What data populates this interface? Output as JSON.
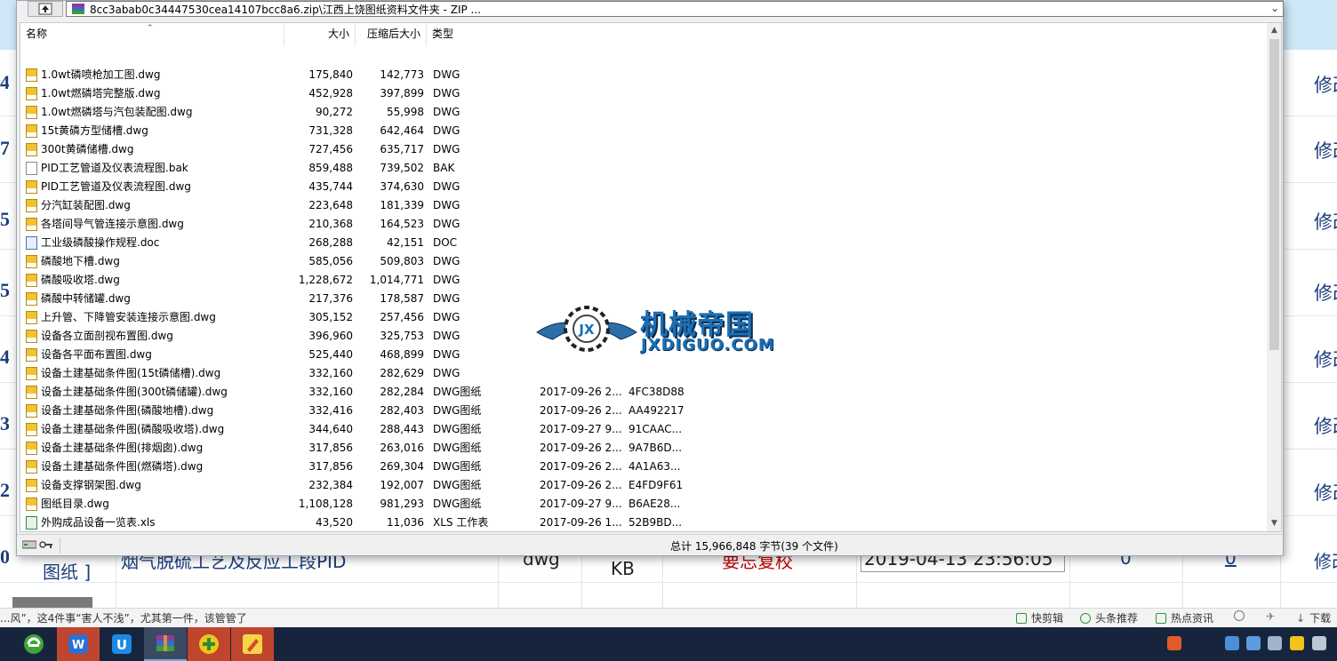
{
  "colors": {
    "bg_topbar": "#cfe8f8",
    "bg_link": "#1a3d7c",
    "bg_red_text": "#c00000",
    "taskbar": "#16253d",
    "watermark": "#1a6fb5"
  },
  "background_page": {
    "left_numbers": [
      "4",
      "7",
      "5",
      "5",
      "4",
      "3",
      "2",
      "0"
    ],
    "edit_label": "修改",
    "last_row": {
      "category": "图纸 ]",
      "title": "烟气脱硫工艺及反应工段PID",
      "format": "dwg",
      "size_unit": "KB",
      "red_text": "要忘复校",
      "datetime": "2019-04-13 23:56:05",
      "count1": "0",
      "count2": "0",
      "edit": "修改"
    }
  },
  "browser_status": {
    "news": "...风”，这4件事“害人不浅”，尤其第一件，该管管了",
    "items": [
      "快剪辑",
      "头条推荐",
      "热点资讯",
      "下载"
    ]
  },
  "winrar": {
    "path": "8cc3abab0c34447530cea14107bcc8a6.zip\\江西上饶图纸资料文件夹 - ZIP ...",
    "columns": {
      "name": "名称",
      "size": "大小",
      "packed": "压缩后大小",
      "type": "类型"
    },
    "files": [
      {
        "name": "1.0wt磷喷枪加工图.dwg",
        "size": "175,840",
        "packed": "142,773",
        "type": "DWG",
        "modified": "",
        "crc": "",
        "icon": "dwg-icon"
      },
      {
        "name": "1.0wt燃磷塔完整版.dwg",
        "size": "452,928",
        "packed": "397,899",
        "type": "DWG",
        "modified": "",
        "crc": "",
        "icon": "dwg-icon"
      },
      {
        "name": "1.0wt燃磷塔与汽包装配图.dwg",
        "size": "90,272",
        "packed": "55,998",
        "type": "DWG",
        "modified": "",
        "crc": "",
        "icon": "dwg-icon"
      },
      {
        "name": "15t黄磷方型储槽.dwg",
        "size": "731,328",
        "packed": "642,464",
        "type": "DWG",
        "modified": "",
        "crc": "",
        "icon": "dwg-icon"
      },
      {
        "name": "300t黄磷储槽.dwg",
        "size": "727,456",
        "packed": "635,717",
        "type": "DWG",
        "modified": "",
        "crc": "",
        "icon": "dwg-icon"
      },
      {
        "name": "PID工艺管道及仪表流程图.bak",
        "size": "859,488",
        "packed": "739,502",
        "type": "BAK",
        "modified": "",
        "crc": "",
        "icon": "bak-icon"
      },
      {
        "name": "PID工艺管道及仪表流程图.dwg",
        "size": "435,744",
        "packed": "374,630",
        "type": "DWG",
        "modified": "",
        "crc": "",
        "icon": "dwg-icon"
      },
      {
        "name": "分汽缸装配图.dwg",
        "size": "223,648",
        "packed": "181,339",
        "type": "DWG",
        "modified": "",
        "crc": "",
        "icon": "dwg-icon"
      },
      {
        "name": "各塔间导气管连接示意图.dwg",
        "size": "210,368",
        "packed": "164,523",
        "type": "DWG",
        "modified": "",
        "crc": "",
        "icon": "dwg-icon"
      },
      {
        "name": "工业级磷酸操作规程.doc",
        "size": "268,288",
        "packed": "42,151",
        "type": "DOC",
        "modified": "",
        "crc": "",
        "icon": "doc-icon"
      },
      {
        "name": "磷酸地下槽.dwg",
        "size": "585,056",
        "packed": "509,803",
        "type": "DWG",
        "modified": "",
        "crc": "",
        "icon": "dwg-icon"
      },
      {
        "name": "磷酸吸收塔.dwg",
        "size": "1,228,672",
        "packed": "1,014,771",
        "type": "DWG",
        "modified": "",
        "crc": "",
        "icon": "dwg-icon"
      },
      {
        "name": "磷酸中转储罐.dwg",
        "size": "217,376",
        "packed": "178,587",
        "type": "DWG",
        "modified": "",
        "crc": "",
        "icon": "dwg-icon"
      },
      {
        "name": "上升管、下降管安装连接示意图.dwg",
        "size": "305,152",
        "packed": "257,456",
        "type": "DWG",
        "modified": "",
        "crc": "",
        "icon": "dwg-icon"
      },
      {
        "name": "设备各立面剖视布置图.dwg",
        "size": "396,960",
        "packed": "325,753",
        "type": "DWG",
        "modified": "",
        "crc": "",
        "icon": "dwg-icon"
      },
      {
        "name": "设备各平面布置图.dwg",
        "size": "525,440",
        "packed": "468,899",
        "type": "DWG",
        "modified": "",
        "crc": "",
        "icon": "dwg-icon"
      },
      {
        "name": "设备土建基础条件图(15t磷储槽).dwg",
        "size": "332,160",
        "packed": "282,629",
        "type": "DWG",
        "modified": "",
        "crc": "",
        "icon": "dwg-icon"
      },
      {
        "name": "设备土建基础条件图(300t磷储罐).dwg",
        "size": "332,160",
        "packed": "282,284",
        "type": "DWG图纸",
        "modified": "2017-09-26 2...",
        "crc": "4FC38D88",
        "icon": "dwg-icon"
      },
      {
        "name": "设备土建基础条件图(磷酸地槽).dwg",
        "size": "332,416",
        "packed": "282,403",
        "type": "DWG图纸",
        "modified": "2017-09-26 2...",
        "crc": "AA492217",
        "icon": "dwg-icon"
      },
      {
        "name": "设备土建基础条件图(磷酸吸收塔).dwg",
        "size": "344,640",
        "packed": "288,443",
        "type": "DWG图纸",
        "modified": "2017-09-27 9...",
        "crc": "91CAAC...",
        "icon": "dwg-icon"
      },
      {
        "name": "设备土建基础条件图(排烟囱).dwg",
        "size": "317,856",
        "packed": "263,016",
        "type": "DWG图纸",
        "modified": "2017-09-26 2...",
        "crc": "9A7B6D...",
        "icon": "dwg-icon"
      },
      {
        "name": "设备土建基础条件图(燃磷塔).dwg",
        "size": "317,856",
        "packed": "269,304",
        "type": "DWG图纸",
        "modified": "2017-09-26 2...",
        "crc": "4A1A63...",
        "icon": "dwg-icon"
      },
      {
        "name": "设备支撑钢架图.dwg",
        "size": "232,384",
        "packed": "192,007",
        "type": "DWG图纸",
        "modified": "2017-09-26 2...",
        "crc": "E4FD9F61",
        "icon": "dwg-icon"
      },
      {
        "name": "图纸目录.dwg",
        "size": "1,108,128",
        "packed": "981,293",
        "type": "DWG图纸",
        "modified": "2017-09-27 9...",
        "crc": "B6AE28...",
        "icon": "dwg-icon"
      },
      {
        "name": "外购成品设备一览表.xls",
        "size": "43,520",
        "packed": "11,036",
        "type": "XLS 工作表",
        "modified": "2017-09-26 1...",
        "crc": "52B9BD...",
        "icon": "xls-icon"
      }
    ],
    "status": "总计 15,966,848 字节(39 个文件)"
  },
  "watermark": {
    "chinese": "机械帝国",
    "english": "JXDIGUO.COM"
  },
  "taskbar": {
    "apps": [
      "browser-icon",
      "wps-icon",
      "u-app-icon",
      "winrar-icon",
      "plus-app-icon",
      "pencil-app-icon"
    ],
    "tray": [
      "sogou-icon",
      "network-icon",
      "chat-icon",
      "file-icon",
      "hand-icon",
      "notes-icon"
    ]
  }
}
